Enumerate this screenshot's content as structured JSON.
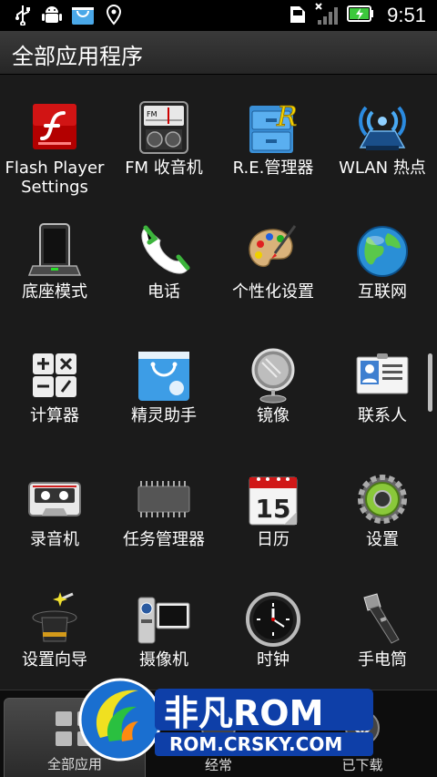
{
  "status_bar": {
    "icons": [
      "usb-icon",
      "android-debug-icon",
      "market-bag-icon",
      "location-icon",
      "sd-card-icon",
      "signal-icon",
      "battery-charging-icon"
    ],
    "time": "9:51"
  },
  "title": "全部应用程序",
  "apps": [
    {
      "label": "Flash Player Settings",
      "icon": "flash-player-icon"
    },
    {
      "label": "FM 收音机",
      "icon": "fm-radio-icon"
    },
    {
      "label": "R.E.管理器",
      "icon": "file-manager-icon"
    },
    {
      "label": "WLAN 热点",
      "icon": "wifi-hotspot-icon"
    },
    {
      "label": "底座模式",
      "icon": "dock-mode-icon"
    },
    {
      "label": "电话",
      "icon": "phone-icon"
    },
    {
      "label": "个性化设置",
      "icon": "palette-icon"
    },
    {
      "label": "互联网",
      "icon": "globe-icon"
    },
    {
      "label": "计算器",
      "icon": "calculator-icon"
    },
    {
      "label": "精灵助手",
      "icon": "shopping-bag-icon"
    },
    {
      "label": "镜像",
      "icon": "mirror-icon"
    },
    {
      "label": "联系人",
      "icon": "contacts-icon"
    },
    {
      "label": "录音机",
      "icon": "cassette-icon"
    },
    {
      "label": "任务管理器",
      "icon": "task-manager-chip-icon"
    },
    {
      "label": "日历",
      "icon": "calendar-icon"
    },
    {
      "label": "设置",
      "icon": "settings-gear-icon"
    },
    {
      "label": "设置向导",
      "icon": "magic-hat-icon"
    },
    {
      "label": "摄像机",
      "icon": "camcorder-icon"
    },
    {
      "label": "时钟",
      "icon": "clock-icon"
    },
    {
      "label": "手电筒",
      "icon": "flashlight-icon"
    }
  ],
  "calendar_day": "15",
  "tabs": [
    {
      "label": "全部应用",
      "active": true
    },
    {
      "label": "经常",
      "active": false
    },
    {
      "label": "已下载",
      "active": false
    }
  ],
  "watermark": {
    "brand": "非凡ROM",
    "url": "ROM.CRSKY.COM"
  }
}
